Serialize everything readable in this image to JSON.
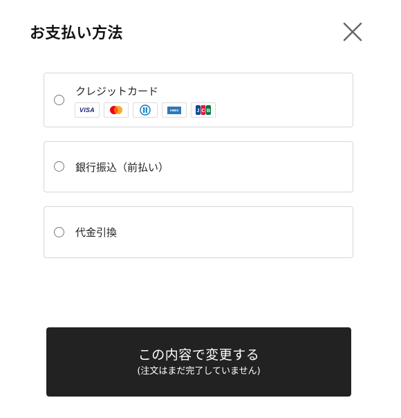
{
  "modal": {
    "title": "お支払い方法",
    "close_icon": "close-icon"
  },
  "payment_options": [
    {
      "label": "クレジットカード",
      "selected": false,
      "brands": [
        {
          "name": "VISA",
          "icon": "visa-icon",
          "color": "#1a1f71"
        },
        {
          "name": "Mastercard",
          "icon": "mastercard-icon",
          "colors": [
            "#eb001b",
            "#f79e1b"
          ]
        },
        {
          "name": "Diners Club",
          "icon": "diners-icon",
          "color": "#0079be"
        },
        {
          "name": "AMEX",
          "icon": "amex-icon",
          "color": "#2e77bc"
        },
        {
          "name": "JCB",
          "icon": "jcb-icon",
          "colors": [
            "#0e4c96",
            "#e21836",
            "#007940"
          ]
        }
      ]
    },
    {
      "label": "銀行振込（前払い）",
      "selected": false
    },
    {
      "label": "代金引換",
      "selected": false
    }
  ],
  "submit": {
    "label": "この内容で変更する",
    "note": "(注文はまだ完了していません)",
    "background": "#222222"
  }
}
